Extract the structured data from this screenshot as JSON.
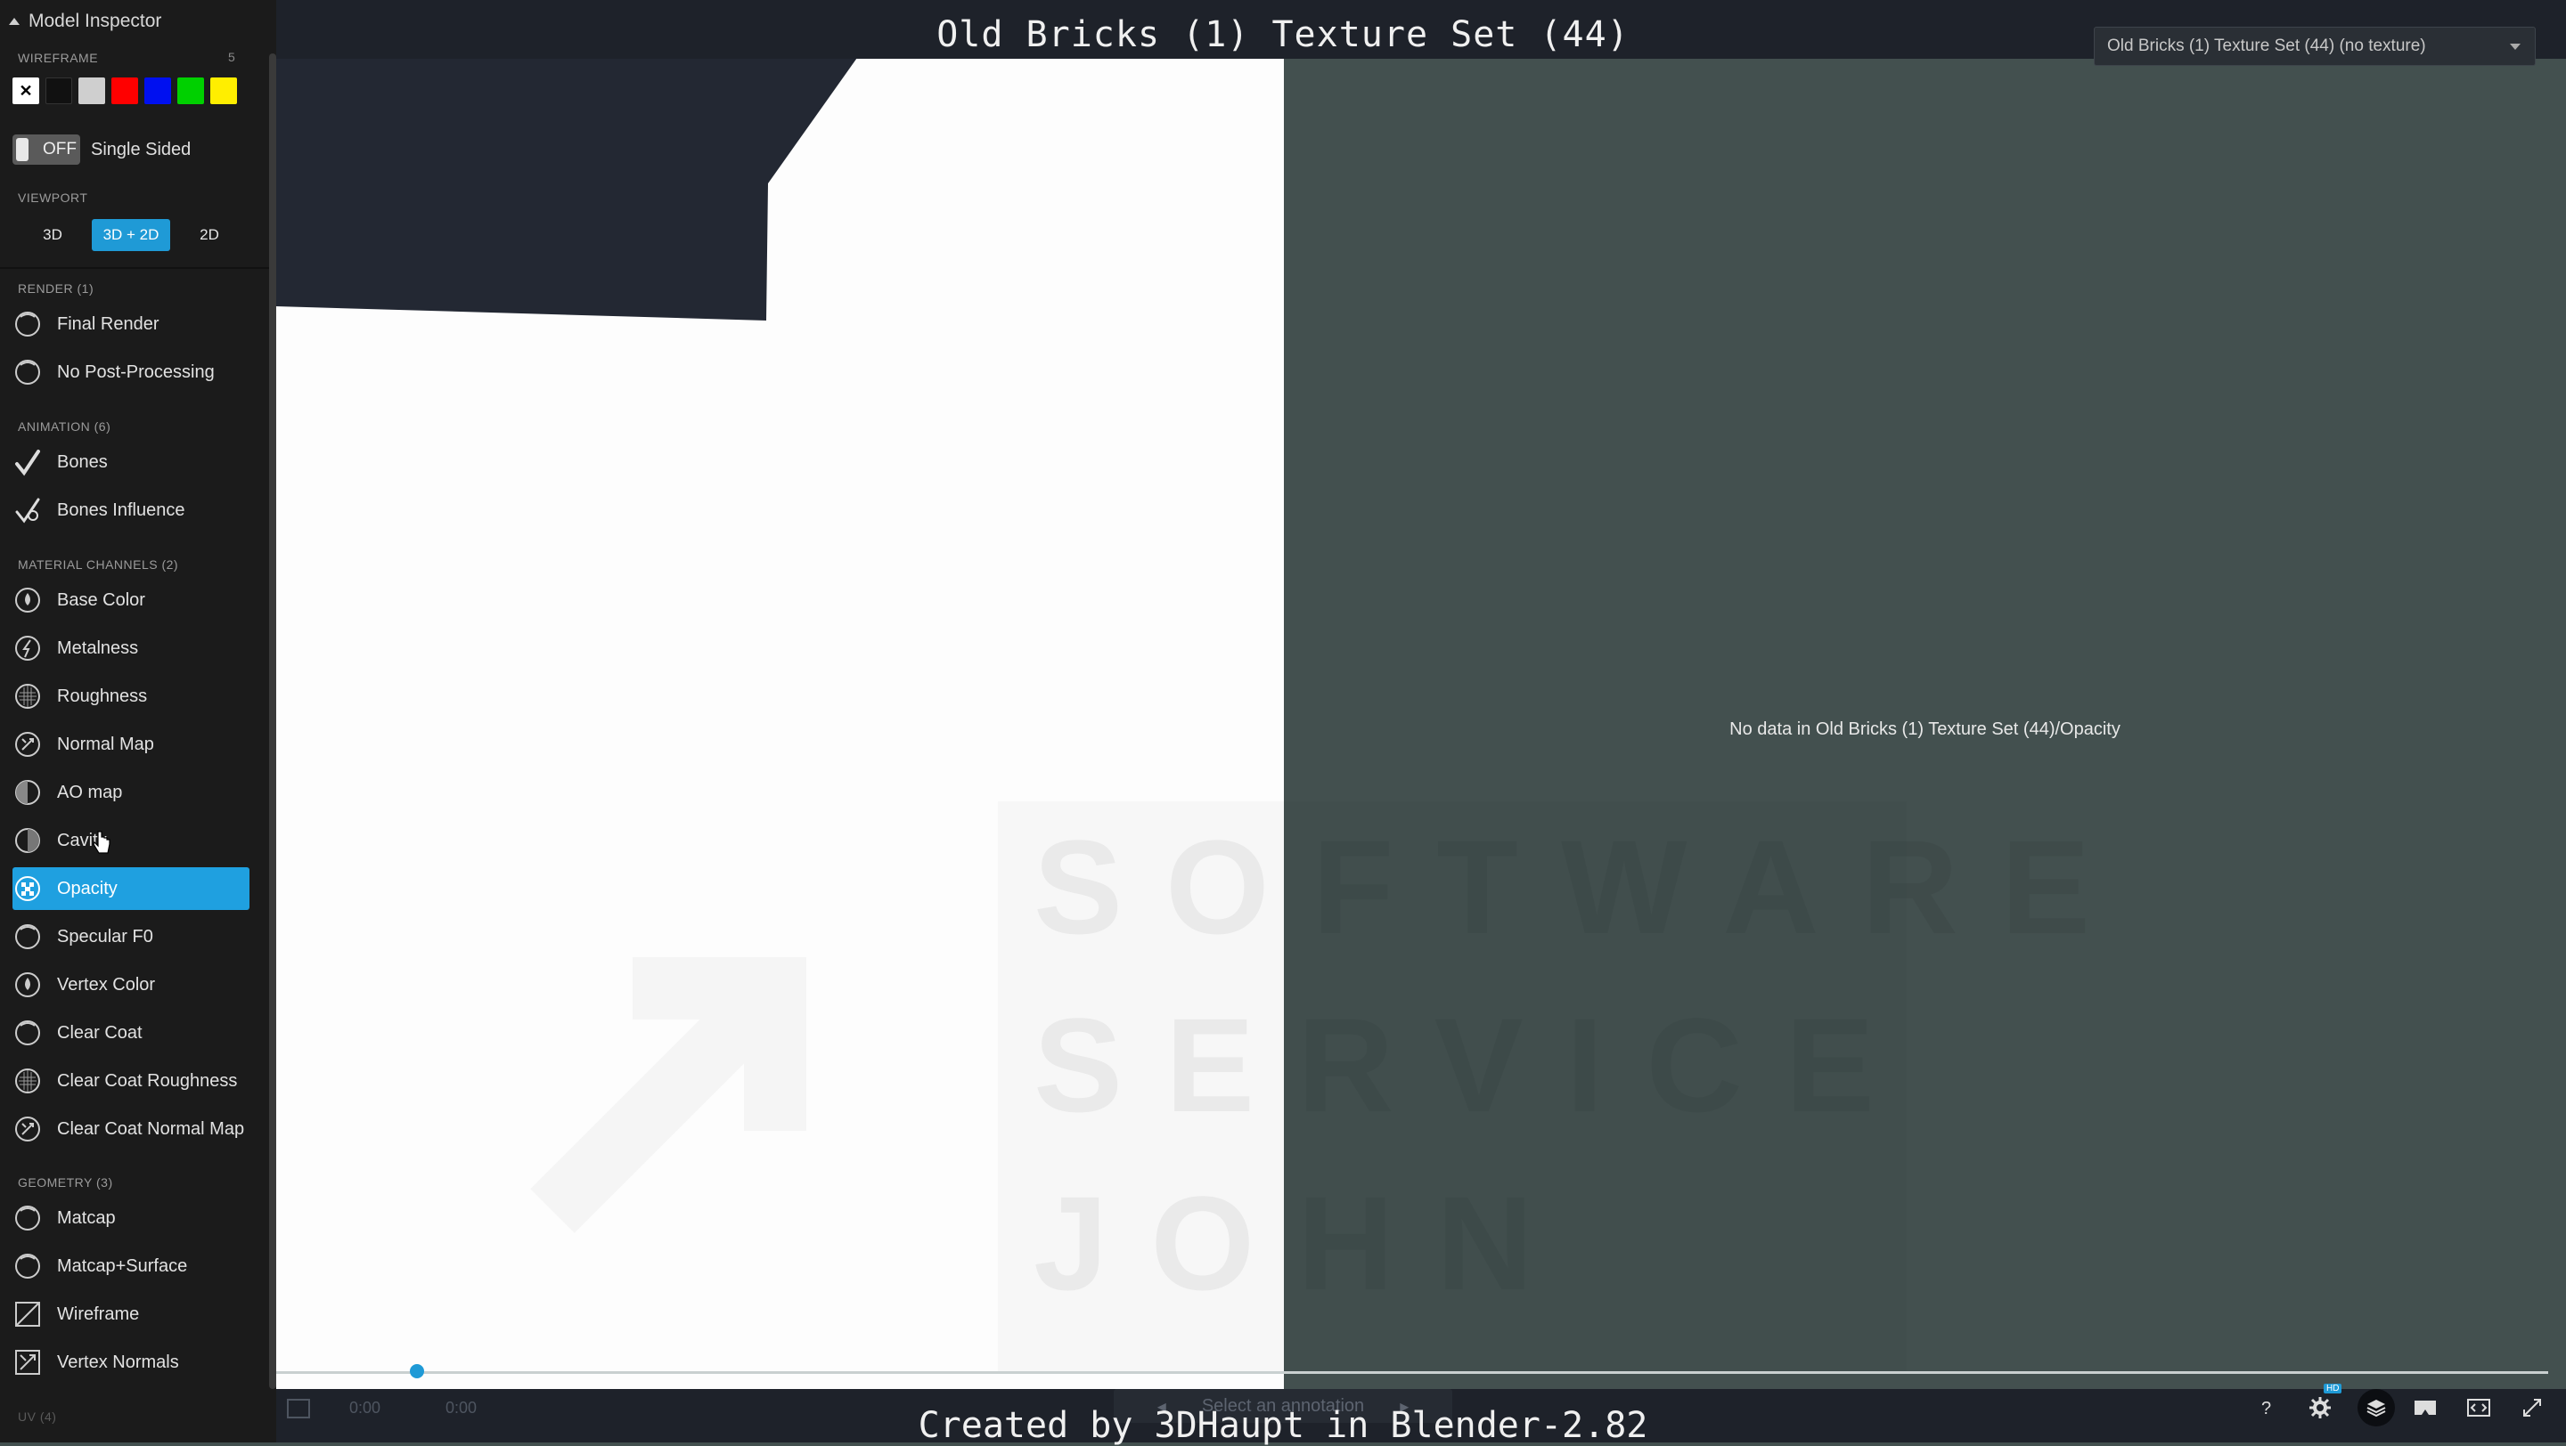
{
  "sidebar": {
    "title": "Model Inspector",
    "wireframe": {
      "label": "WIREFRAME",
      "count": "5",
      "swatches": [
        "#ffffff",
        "#111111",
        "#cccccc",
        "#ff0000",
        "#0000ff",
        "#00cc00",
        "#ffee00"
      ]
    },
    "single_sided": {
      "toggle_text": "OFF",
      "label": "Single Sided"
    },
    "viewport": {
      "label": "VIEWPORT",
      "options": [
        "3D",
        "3D + 2D",
        "2D"
      ],
      "selected": "3D + 2D"
    },
    "sections": [
      {
        "label": "RENDER (1)",
        "items": [
          {
            "label": "Final Render",
            "icon": "sphere-icon"
          },
          {
            "label": "No Post-Processing",
            "icon": "sphere-icon"
          }
        ]
      },
      {
        "label": "ANIMATION (6)",
        "items": [
          {
            "label": "Bones",
            "icon": "bones-icon"
          },
          {
            "label": "Bones Influence",
            "icon": "bones-influence-icon"
          }
        ]
      },
      {
        "label": "MATERIAL CHANNELS (2)",
        "items": [
          {
            "label": "Base Color",
            "icon": "drop-icon"
          },
          {
            "label": "Metalness",
            "icon": "metal-icon"
          },
          {
            "label": "Roughness",
            "icon": "rough-icon"
          },
          {
            "label": "Normal Map",
            "icon": "normal-icon"
          },
          {
            "label": "AO map",
            "icon": "ao-icon"
          },
          {
            "label": "Cavity",
            "icon": "cavity-icon"
          },
          {
            "label": "Opacity",
            "icon": "checker-icon",
            "active": true
          },
          {
            "label": "Specular F0",
            "icon": "sphere-icon"
          },
          {
            "label": "Vertex Color",
            "icon": "drop-icon"
          },
          {
            "label": "Clear Coat",
            "icon": "sphere-icon"
          },
          {
            "label": "Clear Coat Roughness",
            "icon": "rough-icon"
          },
          {
            "label": "Clear Coat Normal Map",
            "icon": "normal-icon"
          }
        ]
      },
      {
        "label": "GEOMETRY (3)",
        "items": [
          {
            "label": "Matcap",
            "icon": "sphere-icon"
          },
          {
            "label": "Matcap+Surface",
            "icon": "sphere-icon"
          },
          {
            "label": "Wireframe",
            "icon": "wireframe-icon"
          },
          {
            "label": "Vertex Normals",
            "icon": "vertex-normals-icon"
          }
        ]
      },
      {
        "label": "UV (4)",
        "items": []
      }
    ]
  },
  "header": {
    "title": "Old Bricks (1) Texture Set (44)",
    "texture_select": "Old Bricks (1) Texture Set (44) (no texture)"
  },
  "viewer": {
    "no_data_message": "No data in Old Bricks (1) Texture Set (44)/Opacity",
    "watermark_lines": [
      "SOFTWARE",
      "SERVICE",
      "JOHN"
    ]
  },
  "footer": {
    "annotation_placeholder": "Select an annotation",
    "faint_labels": [
      "0:00",
      "0:00"
    ],
    "credit": "Created by 3DHaupt in Blender-2.82",
    "badge": "HD",
    "icons": [
      "help-icon",
      "settings-icon",
      "layers-icon",
      "vr-icon",
      "embed-icon",
      "fullscreen-icon"
    ]
  },
  "colors": {
    "accent": "#1f9ad6",
    "sidebar_bg": "#1b1b1b",
    "viewer_bg": "#43504f",
    "bar_bg": "#1e222a"
  }
}
